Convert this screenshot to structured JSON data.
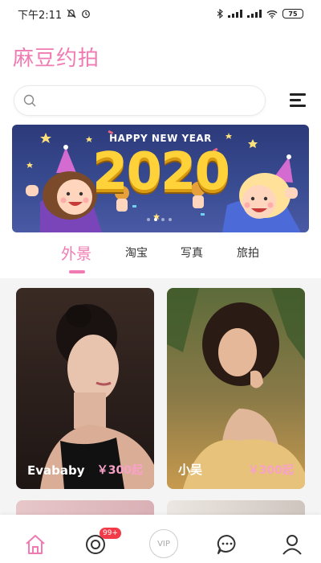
{
  "status_bar": {
    "time": "下午2:11",
    "battery": "75"
  },
  "app_title": "麻豆约拍",
  "search": {
    "value": "",
    "placeholder": ""
  },
  "banner": {
    "caption": "HAPPY NEW YEAR",
    "year": "2020",
    "slide_count": 4,
    "active_slide": 2
  },
  "tabs": [
    {
      "label": "外景",
      "active": true
    },
    {
      "label": "淘宝",
      "active": false
    },
    {
      "label": "写真",
      "active": false
    },
    {
      "label": "旅拍",
      "active": false
    }
  ],
  "cards": [
    {
      "name": "Evababy",
      "price": "￥300起"
    },
    {
      "name": "小吴",
      "price": "￥300起"
    }
  ],
  "bottom_nav": {
    "items": [
      "home-icon",
      "message-center-icon",
      "vip-icon",
      "chat-icon",
      "profile-icon"
    ],
    "badge": "99+",
    "vip_label": "VIP"
  },
  "colors": {
    "accent": "#f07bb3",
    "badge": "#f23b48",
    "price": "#f8a2c8"
  }
}
